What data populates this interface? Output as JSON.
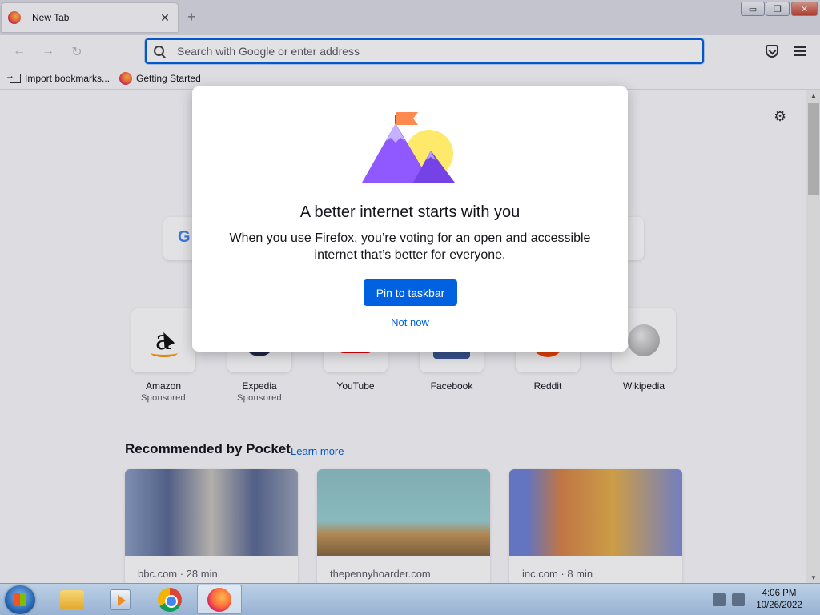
{
  "browser": {
    "tab_title": "New Tab",
    "tab_close": "✕",
    "new_tab_symbol": "+",
    "urlbar_placeholder": "Search with Google or enter address",
    "nav": {
      "back": "←",
      "forward": "→",
      "reload": "↻"
    },
    "window_controls": {
      "minimize": "▭",
      "maximize": "❐",
      "close": "✕"
    }
  },
  "bookmarks": [
    {
      "label": "Import bookmarks...",
      "icon": "import-icon"
    },
    {
      "label": "Getting Started",
      "icon": "firefox-icon"
    }
  ],
  "newtab": {
    "settings_icon": "⚙",
    "search_logo": "G",
    "top_sites": [
      {
        "name": "Amazon",
        "sponsor": "Sponsored",
        "icon": "amazon-icon"
      },
      {
        "name": "Expedia",
        "sponsor": "Sponsored",
        "icon": "expedia-icon"
      },
      {
        "name": "YouTube",
        "sponsor": "",
        "icon": "youtube-icon"
      },
      {
        "name": "Facebook",
        "sponsor": "",
        "icon": "facebook-icon"
      },
      {
        "name": "Reddit",
        "sponsor": "",
        "icon": "reddit-icon"
      },
      {
        "name": "Wikipedia",
        "sponsor": "",
        "icon": "wikipedia-icon"
      }
    ],
    "pocket": {
      "heading": "Recommended by Pocket",
      "learn_more": "Learn more",
      "cards": [
        {
          "source": "bbc.com · 28 min"
        },
        {
          "source": "thepennyhoarder.com"
        },
        {
          "source": "inc.com · 8 min"
        }
      ]
    }
  },
  "modal": {
    "title": "A better internet starts with you",
    "body": "When you use Firefox, you’re voting for an open and accessible internet that’s better for everyone.",
    "primary_button": "Pin to taskbar",
    "secondary_button": "Not now",
    "colors": {
      "primary": "#0061e0",
      "mountain": "#9059ff",
      "flag": "#ff8a50",
      "sun": "#ffe96a"
    }
  },
  "taskbar": {
    "time": "4:06 PM",
    "date": "10/26/2022"
  }
}
